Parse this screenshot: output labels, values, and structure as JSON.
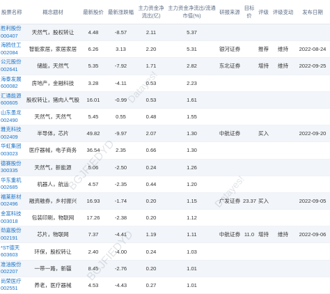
{
  "headers": [
    "股票名称",
    "概念题材",
    "最新股价",
    "最新涨跌幅",
    "主力资金净流出(亿)",
    "主力资金净流出/流通市值(%)",
    "研报来源",
    "目标价",
    "评级",
    "评级变动",
    "发布日期"
  ],
  "rows": [
    {
      "name": "胜利股份",
      "code": "000407",
      "concept": "天然气，股权转让",
      "price": "4.48",
      "chg": "-8.57",
      "flow": "2.11",
      "ratio": "5.37",
      "source": "",
      "target": "",
      "rating": "",
      "change": "",
      "date": ""
    },
    {
      "name": "海鸥住工",
      "code": "002084",
      "concept": "智能家居，家居家居",
      "price": "6.26",
      "chg": "3.13",
      "flow": "2.20",
      "ratio": "5.31",
      "source": "银河证券",
      "target": "",
      "rating": "推荐",
      "change": "维持",
      "date": "2022-08-24"
    },
    {
      "name": "公元股份",
      "code": "002641",
      "concept": "储能，天然气",
      "price": "5.35",
      "chg": "-7.92",
      "flow": "1.71",
      "ratio": "2.82",
      "source": "东北证券",
      "target": "",
      "rating": "增持",
      "change": "维持",
      "date": "2022-09-25"
    },
    {
      "name": "海泰发展",
      "code": "600082",
      "concept": "房地产，金融科技",
      "price": "3.28",
      "chg": "-4.11",
      "flow": "0.53",
      "ratio": "2.23",
      "source": "",
      "target": "",
      "rating": "",
      "change": "",
      "date": ""
    },
    {
      "name": "汇通能源",
      "code": "600605",
      "concept": "股权转让，猪肉人气股",
      "price": "16.01",
      "chg": "-0.99",
      "flow": "0.53",
      "ratio": "1.61",
      "source": "",
      "target": "",
      "rating": "",
      "change": "",
      "date": ""
    },
    {
      "name": "山东墨龙",
      "code": "002490",
      "concept": "天然气，天然气",
      "price": "5.45",
      "chg": "0.55",
      "flow": "0.48",
      "ratio": "1.55",
      "source": "",
      "target": "",
      "rating": "",
      "change": "",
      "date": ""
    },
    {
      "name": "雅克科技",
      "code": "002409",
      "concept": "半导体，芯片",
      "price": "49.82",
      "chg": "-9.97",
      "flow": "2.07",
      "ratio": "1.30",
      "source": "中航证券",
      "target": "",
      "rating": "买入",
      "change": "",
      "date": "2022-09-20"
    },
    {
      "name": "华虹集团",
      "code": "003023",
      "concept": "医疗器械，电子商务",
      "price": "36.54",
      "chg": "2.35",
      "flow": "0.66",
      "ratio": "1.30",
      "source": "",
      "target": "",
      "rating": "",
      "change": "",
      "date": ""
    },
    {
      "name": "德赛股份",
      "code": "300335",
      "concept": "天然气，新能源",
      "price": "5.06",
      "chg": "-2.50",
      "flow": "0.24",
      "ratio": "1.26",
      "source": "",
      "target": "",
      "rating": "",
      "change": "",
      "date": ""
    },
    {
      "name": "华东重机",
      "code": "002685",
      "concept": "机器人，航运",
      "price": "4.57",
      "chg": "-2.35",
      "flow": "0.44",
      "ratio": "1.20",
      "source": "",
      "target": "",
      "rating": "",
      "change": "",
      "date": ""
    },
    {
      "name": "福莱新材",
      "code": "002496",
      "concept": "融资融券，乡村振兴",
      "price": "16.93",
      "chg": "-1.74",
      "flow": "0.20",
      "ratio": "1.15",
      "source": "广发证券",
      "target": "23.37",
      "rating": "买入",
      "change": "",
      "date": "2022-09-05"
    },
    {
      "name": "金富科技",
      "code": "003018",
      "concept": "包装印刷，物联网",
      "price": "17.26",
      "chg": "-2.38",
      "flow": "0.20",
      "ratio": "1.12",
      "source": "",
      "target": "",
      "rating": "",
      "change": "",
      "date": ""
    },
    {
      "name": "劲嘉股份",
      "code": "002191",
      "concept": "芯片，物联网",
      "price": "7.37",
      "chg": "-4.41",
      "flow": "1.19",
      "ratio": "1.11",
      "source": "中航证券",
      "target": "11.0",
      "rating": "增持",
      "change": "维持",
      "date": "2022-09-06"
    },
    {
      "name": "*ST德天",
      "code": "603603",
      "concept": "环保，股权转让",
      "price": "2.40",
      "chg": "-4.00",
      "flow": "0.24",
      "ratio": "1.03",
      "source": "",
      "target": "",
      "rating": "",
      "change": "",
      "date": ""
    },
    {
      "name": "准油股份",
      "code": "002207",
      "concept": "一带一路，新疆",
      "price": "8.45",
      "chg": "-2.76",
      "flow": "0.20",
      "ratio": "1.01",
      "source": "",
      "target": "",
      "rating": "",
      "change": "",
      "date": ""
    },
    {
      "name": "尚荣医疗",
      "code": "002551",
      "concept": "养老，医疗器械",
      "price": "4.53",
      "chg": "-4.43",
      "flow": "0.27",
      "ratio": "1.01",
      "source": "",
      "target": "",
      "rating": "",
      "change": "",
      "date": ""
    }
  ],
  "watermark": [
    "Datayes!",
    "BGJFIEDYD",
    "Datayes!",
    "BGJFIEDYD"
  ],
  "colors": {
    "stock_link": "#1a73c9",
    "header_text": "#5d6d85",
    "row_odd": "#f2f5f9",
    "row_even": "#ffffff"
  }
}
